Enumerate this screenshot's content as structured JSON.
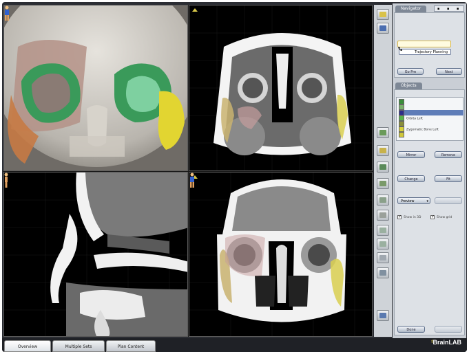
{
  "viewports": {
    "top_left": {
      "info": ""
    },
    "top_right": {
      "info_line1": "",
      "info_line2": ""
    },
    "bottom_left": {
      "info_line1": "",
      "info_line2": ""
    },
    "bottom_right": {
      "info_line1": "",
      "info_line2": ""
    }
  },
  "navigator": {
    "title": "Navigator",
    "step_label": "",
    "steps": [
      "",
      "Trajectory Planning"
    ],
    "back_button": "Go Pre",
    "next_button": "Next"
  },
  "objects": {
    "title": "Objects",
    "items": [
      {
        "label": "",
        "color": "#3a8f3a"
      },
      {
        "label": "",
        "color": "#7bb36b"
      },
      {
        "label": "",
        "color": "#2d2d8a"
      },
      {
        "label": "Orbita Left",
        "color": "#59b34a"
      },
      {
        "label": "",
        "color": "#8a8f3a"
      },
      {
        "label": "Zygomatic Bone Left",
        "color": "#d8d23a"
      },
      {
        "label": "",
        "color": "#cfc73a"
      }
    ],
    "selected_index": 2,
    "button_left": "Mirror",
    "button_right": "Remove",
    "section2_buttons": [
      "Change",
      "Fit"
    ],
    "dropdown_value": "Preview",
    "checkbox1_label": "Show in 3D",
    "checkbox2_label": "Show grid",
    "bottom_button": "Done"
  },
  "bottom_tabs": [
    "Overview",
    "Multiple Sets",
    "Plan Content"
  ],
  "active_tab_index": 0,
  "brand": "BrainLAB",
  "brand_sub": ""
}
